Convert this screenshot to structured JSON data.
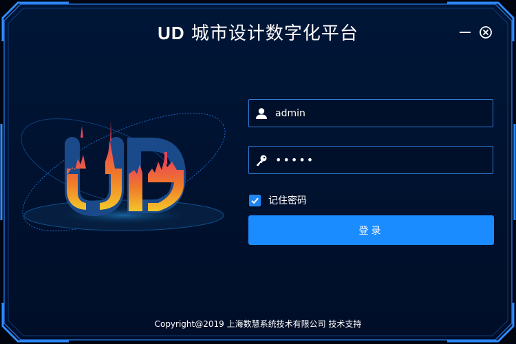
{
  "window": {
    "title_brand": "UD",
    "title_text": "城市设计数字化平台",
    "minimize_icon": "minimize-icon",
    "close_icon": "close-circle-icon"
  },
  "hero": {
    "logo_text": "UD"
  },
  "login": {
    "username_value": "admin",
    "username_icon": "user-icon",
    "password_value": "admin",
    "password_icon": "key-icon",
    "remember_label": "记住密码",
    "remember_checked": true,
    "submit_label": "登录"
  },
  "footer": {
    "copyright": "Copyright@2019 上海数慧系统技术有限公司 技术支持"
  },
  "colors": {
    "background": "#000510",
    "panel": "#001433",
    "border_glow": "#1f6fd6",
    "accent": "#1b8cff"
  }
}
